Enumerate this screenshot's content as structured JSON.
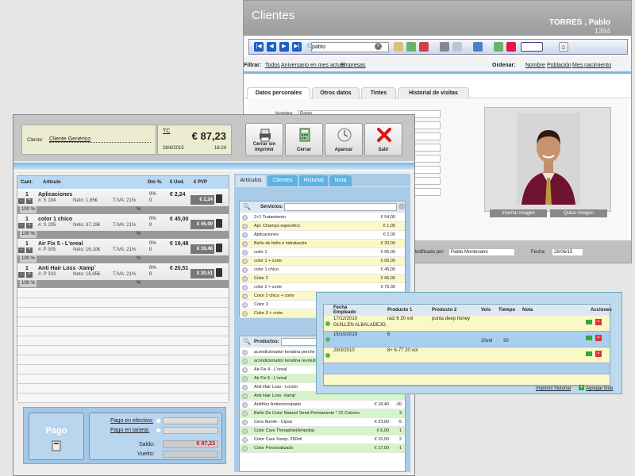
{
  "clientes": {
    "title": "Clientes",
    "client_name": "TORRES , Pablo",
    "client_num": "1394",
    "search_value": "pablo",
    "filter_label": "Filtrar:",
    "filters": [
      "Todos",
      "Aniversario en mes actual",
      "Empresas"
    ],
    "order_label": "Ordenar:",
    "orders": [
      "Nombre",
      "Población",
      "Mes nacimiento"
    ],
    "tabs": [
      "Datos personales",
      "Otros datos",
      "Tintes",
      "Historial de visitas"
    ],
    "field_nombre_label": "Nombre:",
    "field_nombre_value": "Pablo",
    "btn_insert_image": "Insertar imagen",
    "btn_remove_image": "Quitar  imagen",
    "modified_label": "Modificado por:",
    "modified_value": "Pablo Montesano",
    "date_label": "Fecha:",
    "date_value": "28/06/15"
  },
  "tpv": {
    "client_label": "Cliente:",
    "client_value": "Cliente Genérico",
    "ticket_code": "TC",
    "total": "€ 87,23",
    "date": "28/6/2015",
    "time": "16:24",
    "buttons": {
      "close_no_print": "Cerrar sin imprimir",
      "close": "Cerrar",
      "park": "Aparcar",
      "exit": "Salir"
    },
    "columns": [
      "Cant.",
      "Artículo",
      "Dto %.",
      "€ Und.",
      "€ PVP"
    ],
    "lines": [
      {
        "qty": "1",
        "name": "Aplicaciones",
        "ref": "#: S 194",
        "neto": "Neto: 1,85€",
        "iva": "T.IVA: 21%",
        "dto": "0%",
        "dto2": "0",
        "unit": "€ 2,24",
        "pvp": "€ 2,24",
        "pct": "100 %"
      },
      {
        "qty": "1",
        "name": "color 1 chico",
        "ref": "#: S 295",
        "neto": "Neto: 37,19€",
        "iva": "T.IVA: 21%",
        "dto": "0%",
        "dto2": "0",
        "unit": "€ 45,00",
        "pvp": "€ 45,00",
        "pct": "100 %"
      },
      {
        "qty": "1",
        "name": "Air Fix 5 - L'oreal",
        "ref": "#: P 305",
        "neto": "Neto: 16,10€",
        "iva": "T.IVA: 21%",
        "dto": "0%",
        "dto2": "0",
        "unit": "€ 19,48",
        "pvp": "€ 19,48",
        "pct": "100 %"
      },
      {
        "qty": "1",
        "name": "Anti Hair Loss -Xamp`",
        "ref": "#: P 303",
        "neto": "Neto: 16,95€",
        "iva": "T.IVA: 21%",
        "dto": "0%",
        "dto2": "0",
        "unit": "€ 20,51",
        "pvp": "€ 20,51",
        "pct": "100 %"
      }
    ],
    "pago": "Pago",
    "pay_cash": "Pago en efectivo:",
    "pay_card": "Pago en tarjeta:",
    "saldo_label": "Saldo:",
    "saldo_value": "€ 87,23",
    "vuelto_label": "Vuelto:",
    "right_tabs": [
      "Artículos",
      "Clientes",
      "Historial",
      "Nota"
    ],
    "services_label": "Servicios:",
    "services": [
      {
        "name": "2+1 Tratamiento",
        "price": "€ 54,00"
      },
      {
        "name": "Apl. Champú especifico",
        "price": "€ 1,00"
      },
      {
        "name": "Aplicaciones",
        "price": "€ 2,00"
      },
      {
        "name": "Baño de brillo e hidratación",
        "price": "€ 20,00"
      },
      {
        "name": "color 1",
        "price": "€ 56,00"
      },
      {
        "name": "color 1 + corte",
        "price": "€ 65,00"
      },
      {
        "name": "color 1 chico",
        "price": "€ 45,00"
      },
      {
        "name": "Color 2",
        "price": "€ 65,00"
      },
      {
        "name": "color 2 + corte",
        "price": "€ 75,00"
      },
      {
        "name": "Color 2 chico + corte",
        "price": ""
      },
      {
        "name": "Color 3",
        "price": ""
      },
      {
        "name": "Color 3 + corte",
        "price": ""
      }
    ],
    "products_label": "Productos:",
    "products": [
      {
        "name": "acondicionador keratina perche",
        "price": ""
      },
      {
        "name": "acondicionador keratina revoluti",
        "price": ""
      },
      {
        "name": "Air Fix 4 - L'oreal",
        "price": ""
      },
      {
        "name": "Air Fix 5 - L'oreal",
        "price": ""
      },
      {
        "name": "Anti Hair Loss - Loción",
        "price": ""
      },
      {
        "name": "Anti Hair Loss -Xamp`",
        "price": ""
      },
      {
        "name": "Antifrizz Antiencrespado",
        "price": "€ 18,40"
      },
      {
        "name": "Baño De Color Naturel Semi-Permanente * 22 Colores",
        "price": ""
      },
      {
        "name": "Cera Nunile - Cipsa",
        "price": "€ 23,00"
      },
      {
        "name": "Color Care Theraphie(Ampolla)",
        "price": "€ 6,00"
      },
      {
        "name": "Color Care Xamp. 250ml",
        "price": "€ 15,00"
      },
      {
        "name": "Color Personalizado",
        "price": "€ 17,00"
      }
    ],
    "product_stock": [
      "",
      "",
      "",
      "",
      "",
      "",
      "-30",
      "3",
      "-5",
      "1",
      "2",
      "-1"
    ]
  },
  "tintes": {
    "columns": [
      "Fecha",
      "Empleado",
      "Producto 1",
      "Producto 2",
      "Vols",
      "Tiempo",
      "Nota",
      "Acciones"
    ],
    "rows": [
      {
        "fecha": "17/12/2010",
        "empleado": "GUILLEN ALBALADEJO,",
        "p1": "raiz 6 20 vol",
        "p2": "punta deep honey",
        "vols": "",
        "tiempo": "",
        "nota": ""
      },
      {
        "fecha": "15/10/2010",
        "empleado": "",
        "p1": "6",
        "p2": "",
        "vols": "20vol",
        "tiempo": "30",
        "nota": ""
      },
      {
        "fecha": "29/3/2010",
        "empleado": "",
        "p1": "8+ 6-77 20 vol",
        "p2": "",
        "vols": "",
        "tiempo": "",
        "nota": ""
      }
    ],
    "print_history": "Imprimir historial",
    "add_tint": "Agregar tinte"
  }
}
